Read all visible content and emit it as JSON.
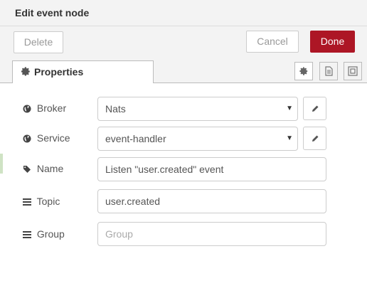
{
  "dialog": {
    "title": "Edit event node",
    "delete_label": "Delete",
    "cancel_label": "Cancel",
    "done_label": "Done",
    "accent_color": "#ad1625"
  },
  "tabs": {
    "properties_label": "Properties",
    "icons": [
      "gear-icon",
      "description-icon",
      "appearance-icon"
    ]
  },
  "form": {
    "broker": {
      "label": "Broker",
      "value": "Nats",
      "icon": "globe-icon"
    },
    "service": {
      "label": "Service",
      "value": "event-handler",
      "icon": "globe-icon"
    },
    "name": {
      "label": "Name",
      "value": "Listen \"user.created\" event",
      "icon": "tag-icon"
    },
    "topic": {
      "label": "Topic",
      "value": "user.created",
      "icon": "list-icon"
    },
    "group": {
      "label": "Group",
      "value": "",
      "placeholder": "Group",
      "icon": "list-icon"
    }
  }
}
